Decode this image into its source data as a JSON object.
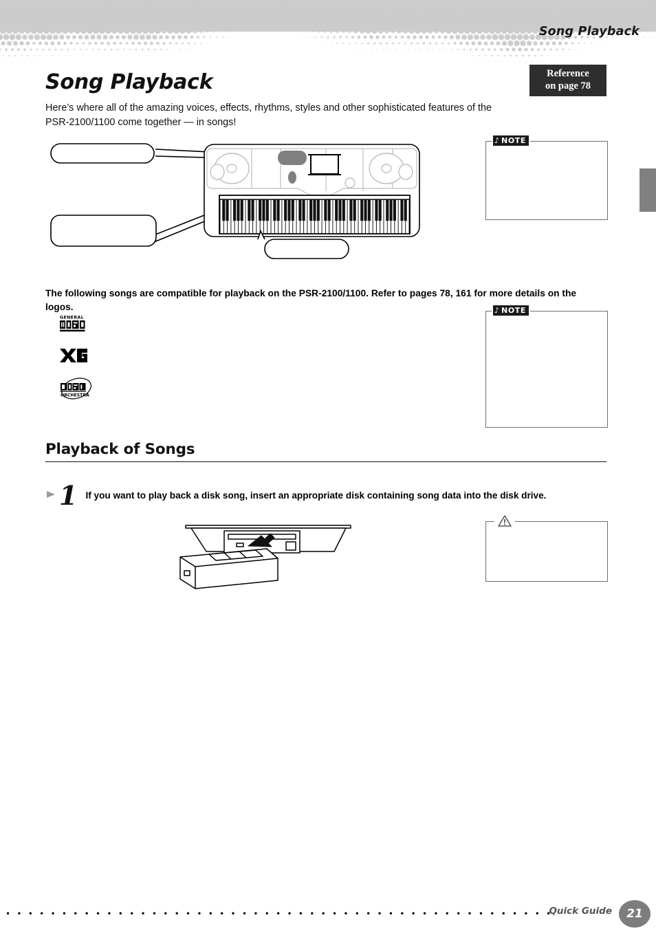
{
  "header": {
    "running_head": "Song Playback",
    "tab_marker_color": "#808080"
  },
  "title": {
    "page_title": "Song Playback"
  },
  "reference_badge": {
    "line1": "Reference",
    "line2": "on page 78",
    "background": "#2e2e2e",
    "text_color": "#ffffff"
  },
  "intro": {
    "paragraph": "Here’s where all of the amazing voices, effects, rhythms, styles and other sophisticated features of the PSR-2100/1100 come together — in songs!"
  },
  "keyboard_figure": {
    "callouts": [
      {
        "id": "callout-top-left",
        "text": ""
      },
      {
        "id": "callout-bottom-left",
        "text": ""
      },
      {
        "id": "callout-bottom-center",
        "text": ""
      }
    ],
    "instrument": "PSR-2100/1100 keyboard front panel"
  },
  "logos_section": {
    "paragraph": "The following songs are compatible for playback on the PSR-2100/1100. Refer to pages 78, 161 for more details on the logos.",
    "logos": [
      {
        "name": "general-midi-logo",
        "top": "GENERAL",
        "main": "MIDI"
      },
      {
        "name": "xg-logo",
        "main": "XG"
      },
      {
        "name": "disk-orchestra-logo",
        "main": "DISK",
        "sub": "ORCHESTRA"
      }
    ]
  },
  "notes": [
    {
      "id": "note-box-1",
      "label": "NOTE",
      "glyph": "♪",
      "body": ""
    },
    {
      "id": "note-box-2",
      "label": "NOTE",
      "glyph": "♪",
      "body": ""
    }
  ],
  "caution": {
    "id": "caution-box-1",
    "icon": "warning-triangle-icon",
    "body": ""
  },
  "section": {
    "heading": "Playback of Songs"
  },
  "steps": [
    {
      "number": "1",
      "text": "If you want to play back a disk song, insert an appropriate disk containing song data into the disk drive."
    }
  ],
  "disk_figure": {
    "caption": "",
    "description": "floppy disk being inserted into the disk drive"
  },
  "footer": {
    "guide_label": "Quick Guide",
    "page_number": "21",
    "page_circle_color": "#7d7d7d"
  }
}
